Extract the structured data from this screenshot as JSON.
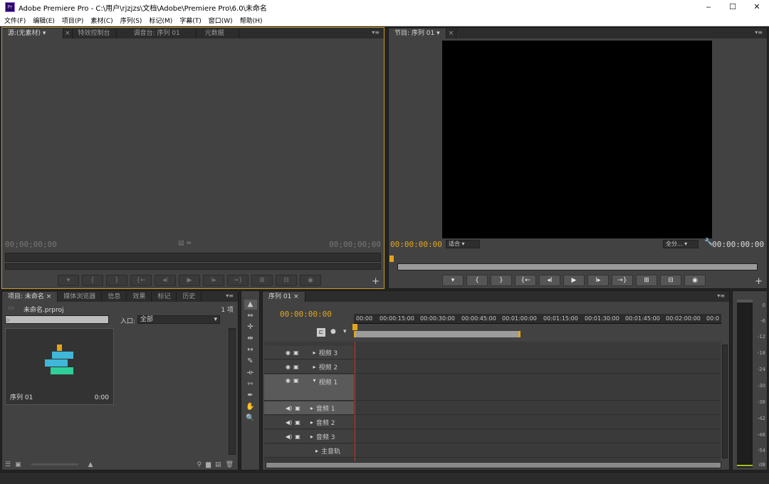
{
  "window": {
    "title": "Adobe Premiere Pro - C:\\用户\\rjzjzs\\文档\\Adobe\\Premiere Pro\\6.0\\未命名",
    "logo": "Pr",
    "min": "‒",
    "max": "☐",
    "close": "✕"
  },
  "menu": [
    "文件(F)",
    "编辑(E)",
    "项目(P)",
    "素材(C)",
    "序列(S)",
    "标记(M)",
    "字幕(T)",
    "窗口(W)",
    "帮助(H)"
  ],
  "source": {
    "tabs": [
      "源:(无素材) ▾",
      "特效控制台",
      "调音台: 序列 01",
      "元数据"
    ],
    "close": "×",
    "tc_left": "00;00;00;00",
    "tc_right": "00;00;00;00",
    "controls": [
      "▾",
      "{",
      "}",
      "{←",
      "◂I",
      "▶",
      "I▸",
      "→}",
      "⊞",
      "⊟",
      "◉"
    ],
    "plus": "+"
  },
  "program": {
    "tab": "节目: 序列 01 ▾",
    "close": "×",
    "timecode": "00:00:00:00",
    "fit": "适合 ▾",
    "resolution": "全分... ▾",
    "wrench": "🔧",
    "timecode_right": "00:00:00:00",
    "controls": [
      "▾",
      "{",
      "}",
      "{←",
      "◂I",
      "▶",
      "I▸",
      "→}",
      "⊞",
      "⊟",
      "◉"
    ],
    "plus": "+"
  },
  "project": {
    "tabs": [
      "项目: 未命名 ×",
      "媒体浏览器",
      "信息",
      "效果",
      "标记",
      "历史"
    ],
    "filename": "未命名.prproj",
    "count": "1 项",
    "search_placeholder": "ρ-",
    "entry_label": "入口:",
    "entry_value": "全部",
    "clip_name": "序列 01",
    "clip_duration": "0:00"
  },
  "tools": [
    "▲",
    "⇔",
    "✛",
    "⇹",
    "↔",
    "✎",
    "⟛",
    "⇿",
    "✒",
    "✋",
    "🔍"
  ],
  "timeline": {
    "tab": "序列 01 ×",
    "timecode": "00:00:00:00",
    "ruler": [
      "00:00",
      "00:00:15:00",
      "00:00:30:00",
      "00:00:45:00",
      "00:01:00:00",
      "00:01:15:00",
      "00:01:30:00",
      "00:01:45:00",
      "00:02:00:00",
      "00:0"
    ],
    "tracks": [
      {
        "name": "视频 3",
        "icons": "◉ ▣"
      },
      {
        "name": "视频 2",
        "icons": "◉ ▣"
      },
      {
        "name": "视频 1",
        "icons": "◉ ▣"
      },
      {
        "name": "音频 1",
        "icons": "◀) ▣"
      },
      {
        "name": "音频 2",
        "icons": "◀) ▣"
      },
      {
        "name": "音频 3",
        "icons": "◀) ▣"
      },
      {
        "name": "主音轨",
        "icons": ""
      }
    ]
  },
  "meter": {
    "ticks": [
      "0",
      "-6",
      "-12",
      "-18",
      "-24",
      "-30",
      "-36",
      "-42",
      "-48",
      "-54",
      "dB"
    ]
  },
  "colors": {
    "accent": "#e3a51c",
    "active_border": "#c69a2a",
    "playhead": "#c0392b",
    "clip_blue": "#3fb7d9",
    "clip_green": "#2fcf9a"
  }
}
